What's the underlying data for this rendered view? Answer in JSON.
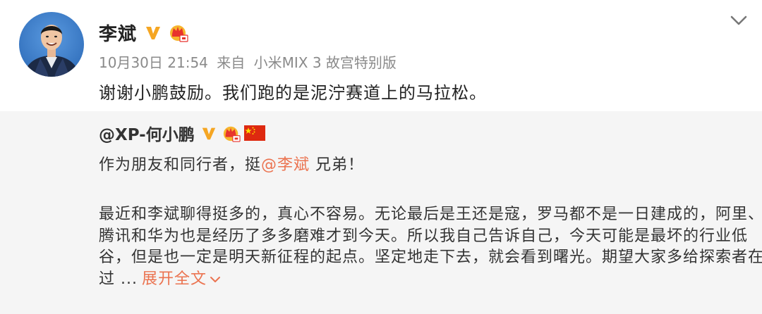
{
  "post": {
    "author": "李斌",
    "timestamp": "10月30日 21:54",
    "source_prefix": "来自",
    "source_device": "小米MIX 3 故宫特别版",
    "text": "谢谢小鹏鼓励。我们跑的是泥泞赛道上的马拉松。",
    "icons": {
      "vip": "verified-v-icon",
      "crown": "crown-badge-icon",
      "menu": "chevron-down-icon"
    }
  },
  "repost": {
    "author": "@XP-何小鹏",
    "line1_prefix": "作为朋友和同行者，挺",
    "line1_mention": "@李斌",
    "line1_suffix": " 兄弟！",
    "body_lines": [
      "最近和李斌聊得挺多的，真心不容易。无论最后是王还是寇，罗马都不是一日建成的，阿里、",
      "腾讯和华为也是经历了多多磨难才到今天。所以我自己告诉自己，今天可能是最坏的行业低",
      "谷，但是也一定是明天新征程的起点。坚定地走下去，就会看到曙光。期望大家多给探索者在",
      "过 ..."
    ],
    "expand_label": "展开全文",
    "icons": {
      "vip": "verified-v-icon",
      "crown": "crown-badge-icon",
      "flag": "china-flag-icon"
    }
  },
  "colors": {
    "mention": "#eb7350",
    "vip_gold": "#f5a623",
    "repost_bg": "#f5f5f5",
    "meta": "#8a8a8a"
  }
}
